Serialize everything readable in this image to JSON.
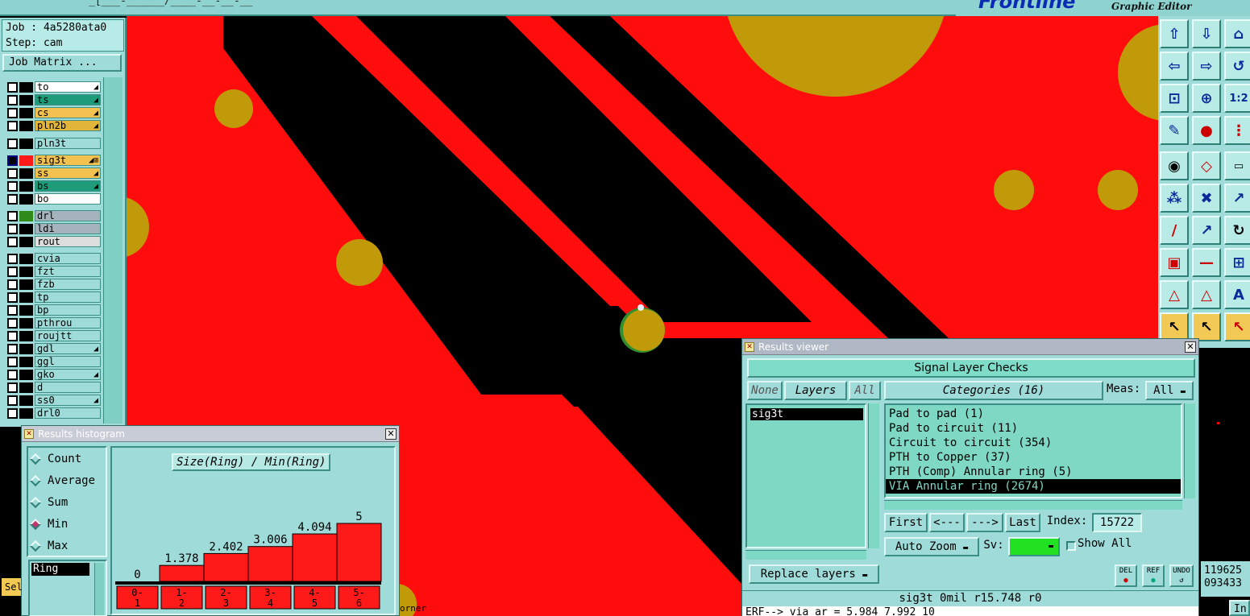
{
  "app": {
    "brand": "Frontline",
    "subtitle": "Graphic Editor",
    "menu_fragment": "_[___-______/____-__-__-__"
  },
  "job": {
    "job_line": "Job : 4a5280ata0",
    "step_line": "Step: cam",
    "matrix_button": "Job Matrix ..."
  },
  "layers_group1": [
    {
      "name": "to",
      "color": "#ffffff",
      "mark": "◢"
    },
    {
      "name": "ts",
      "color": "#1e9c79",
      "mark": "◢"
    },
    {
      "name": "cs",
      "color": "#f2c14f",
      "mark": "◢"
    },
    {
      "name": "pln2b",
      "color": "#e3b43a",
      "mark": "◢"
    }
  ],
  "layers_group2": [
    {
      "name": "pln3t",
      "color": "#9fdcd9",
      "mark": ""
    }
  ],
  "layers_group3": [
    {
      "name": "sig3t",
      "color": "#f2c14f",
      "mark": "◢⊞",
      "active": true
    },
    {
      "name": "ss",
      "color": "#f2c14f",
      "mark": "◢"
    },
    {
      "name": "bs",
      "color": "#1e9c79",
      "mark": "◢"
    },
    {
      "name": "bo",
      "color": "#ffffff",
      "mark": ""
    }
  ],
  "layers_group4": [
    {
      "name": "drl",
      "color": "#a5b4bc",
      "mark": ""
    },
    {
      "name": "ldi",
      "color": "#a5b4bc",
      "mark": ""
    },
    {
      "name": "rout",
      "color": "#dddddd",
      "mark": ""
    }
  ],
  "layers_group5": [
    {
      "name": "cvia",
      "color": "#9fdcd9",
      "mark": ""
    },
    {
      "name": "fzt",
      "color": "#9fdcd9",
      "mark": ""
    },
    {
      "name": "fzb",
      "color": "#9fdcd9",
      "mark": ""
    },
    {
      "name": "tp",
      "color": "#9fdcd9",
      "mark": ""
    },
    {
      "name": "bp",
      "color": "#9fdcd9",
      "mark": ""
    },
    {
      "name": "pthrou",
      "color": "#9fdcd9",
      "mark": ""
    },
    {
      "name": "roujtt",
      "color": "#9fdcd9",
      "mark": ""
    },
    {
      "name": "gdl",
      "color": "#9fdcd9",
      "mark": "◢"
    },
    {
      "name": "ggl",
      "color": "#9fdcd9",
      "mark": ""
    },
    {
      "name": "gko",
      "color": "#9fdcd9",
      "mark": "◢"
    },
    {
      "name": "d",
      "color": "#9fdcd9",
      "mark": ""
    },
    {
      "name": "ss0",
      "color": "#9fdcd9",
      "mark": "◢"
    },
    {
      "name": "drl0",
      "color": "#9fdcd9",
      "mark": ""
    }
  ],
  "histogram": {
    "window_title": "Results histogram",
    "modes": [
      {
        "label": "Count",
        "selected": false
      },
      {
        "label": "Average",
        "selected": false
      },
      {
        "label": "Sum",
        "selected": false
      },
      {
        "label": "Min",
        "selected": true
      },
      {
        "label": "Max",
        "selected": false
      }
    ],
    "field_value": "Ring",
    "plot_title": "Size(Ring) / Min(Ring)"
  },
  "chart_data": {
    "type": "bar",
    "title": "Size(Ring) / Min(Ring)",
    "categories": [
      "0-\n1",
      "1-\n2",
      "2-\n3",
      "3-\n4",
      "4-\n5",
      "5-\n6"
    ],
    "category_labels_top": [
      "0-",
      "1-",
      "2-",
      "3-",
      "4-",
      "5-"
    ],
    "category_labels_bottom": [
      "1",
      "2",
      "3",
      "4",
      "5",
      "6"
    ],
    "values": [
      0,
      1.378,
      2.402,
      3.006,
      4.094,
      5
    ],
    "value_labels": [
      "0",
      "1.378",
      "2.402",
      "3.006",
      "4.094",
      "5"
    ],
    "ylim": [
      0,
      5
    ],
    "bar_color": "#ff1a1a"
  },
  "results_viewer": {
    "window_title": "Results viewer",
    "header": "Signal Layer Checks",
    "none_btn": "None",
    "layers_btn": "Layers",
    "all_btn": "All",
    "layer_list": [
      "sig3t"
    ],
    "categories_btn": "Categories (16)",
    "meas_label": "Meas:",
    "meas_value": "All",
    "categories": [
      {
        "label": "Pad to pad (1)",
        "selected": false
      },
      {
        "label": "Pad to circuit (11)",
        "selected": false
      },
      {
        "label": "Circuit to circuit (354)",
        "selected": false
      },
      {
        "label": "PTH to Copper (37)",
        "selected": false
      },
      {
        "label": "PTH (Comp) Annular ring (5)",
        "selected": false
      },
      {
        "label": "VIA Annular ring (2674)",
        "selected": true
      }
    ],
    "first_btn": "First",
    "prev_btn": "<---",
    "next_btn": "--->",
    "last_btn": "Last",
    "index_label": "Index:",
    "index_value": "15722",
    "auto_zoom": "Auto Zoom",
    "sv_label": "Sv:",
    "show_all": "Show All",
    "replace_layers": "Replace layers",
    "del_label": "DEL",
    "ref_label": "REF",
    "undo_label": "UNDO",
    "status": "sig3t  0mil   r15.748  r0",
    "command": "ERF--> via_ar = 5.984 7.992 10"
  },
  "coords": {
    "x": "119625",
    "y": "093433"
  },
  "misc": {
    "corner_text": "orner",
    "sel_tab": "Sel",
    "in_btn": "In"
  },
  "colors": {
    "copper": "#ff0d0d",
    "track": "#000000",
    "pad": "#c19a0a",
    "panel": "#9fdcd9"
  }
}
